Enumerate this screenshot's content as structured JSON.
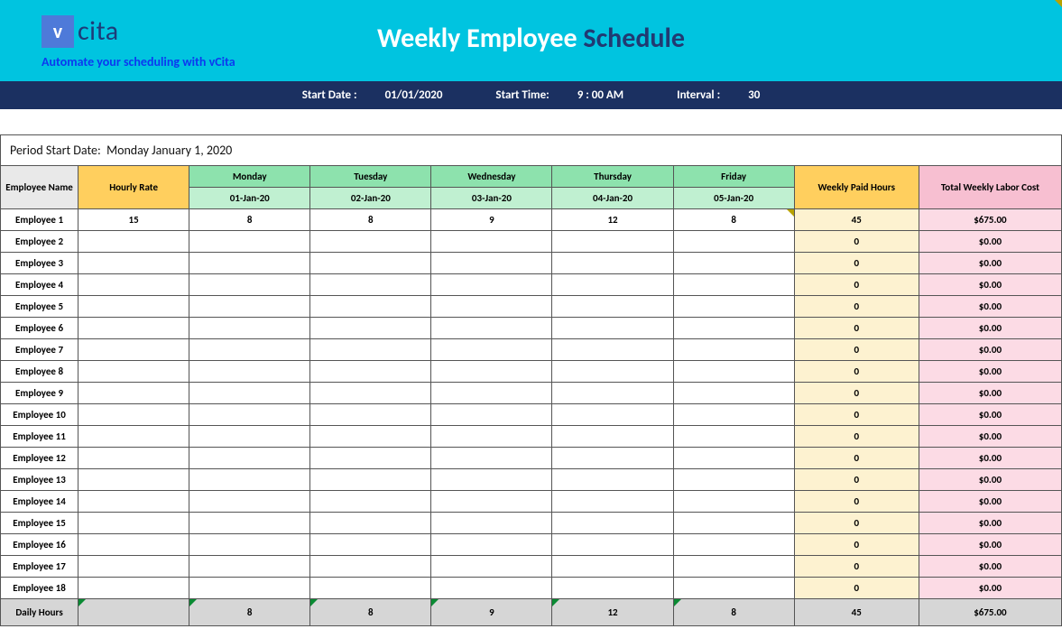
{
  "banner": {
    "logo_letter": "v",
    "logo_text": "cita",
    "tagline": "Automate your scheduling with vCita",
    "title_left": "Weekly Employee ",
    "title_right": "Schedule"
  },
  "infobar": {
    "start_date_label": "Start Date :",
    "start_date": "01/01/2020",
    "start_time_label": "Start Time:",
    "start_time": "9 : 00 AM",
    "interval_label": "Interval :",
    "interval": "30"
  },
  "period": {
    "label": "Period Start Date:",
    "value": "Monday January 1, 2020"
  },
  "headers": {
    "employee_name": "Employee Name",
    "hourly_rate": "Hourly Rate",
    "weekly_paid_hours": "Weekly Paid Hours",
    "total_cost": "Total Weekly Labor Cost",
    "daily_hours": "Daily Hours"
  },
  "days": [
    {
      "name": "Monday",
      "date": "01-Jan-20"
    },
    {
      "name": "Tuesday",
      "date": "02-Jan-20"
    },
    {
      "name": "Wednesday",
      "date": "03-Jan-20"
    },
    {
      "name": "Thursday",
      "date": "04-Jan-20"
    },
    {
      "name": "Friday",
      "date": "05-Jan-20"
    }
  ],
  "employees": [
    {
      "name": "Employee 1",
      "rate": "15",
      "hours": [
        "8",
        "8",
        "9",
        "12",
        "8"
      ],
      "weekly": "45",
      "cost": "$675.00"
    },
    {
      "name": "Employee 2",
      "rate": "",
      "hours": [
        "",
        "",
        "",
        "",
        ""
      ],
      "weekly": "0",
      "cost": "$0.00"
    },
    {
      "name": "Employee 3",
      "rate": "",
      "hours": [
        "",
        "",
        "",
        "",
        ""
      ],
      "weekly": "0",
      "cost": "$0.00"
    },
    {
      "name": "Employee 4",
      "rate": "",
      "hours": [
        "",
        "",
        "",
        "",
        ""
      ],
      "weekly": "0",
      "cost": "$0.00"
    },
    {
      "name": "Employee 5",
      "rate": "",
      "hours": [
        "",
        "",
        "",
        "",
        ""
      ],
      "weekly": "0",
      "cost": "$0.00"
    },
    {
      "name": "Employee 6",
      "rate": "",
      "hours": [
        "",
        "",
        "",
        "",
        ""
      ],
      "weekly": "0",
      "cost": "$0.00"
    },
    {
      "name": "Employee 7",
      "rate": "",
      "hours": [
        "",
        "",
        "",
        "",
        ""
      ],
      "weekly": "0",
      "cost": "$0.00"
    },
    {
      "name": "Employee 8",
      "rate": "",
      "hours": [
        "",
        "",
        "",
        "",
        ""
      ],
      "weekly": "0",
      "cost": "$0.00"
    },
    {
      "name": "Employee 9",
      "rate": "",
      "hours": [
        "",
        "",
        "",
        "",
        ""
      ],
      "weekly": "0",
      "cost": "$0.00"
    },
    {
      "name": "Employee 10",
      "rate": "",
      "hours": [
        "",
        "",
        "",
        "",
        ""
      ],
      "weekly": "0",
      "cost": "$0.00"
    },
    {
      "name": "Employee 11",
      "rate": "",
      "hours": [
        "",
        "",
        "",
        "",
        ""
      ],
      "weekly": "0",
      "cost": "$0.00"
    },
    {
      "name": "Employee 12",
      "rate": "",
      "hours": [
        "",
        "",
        "",
        "",
        ""
      ],
      "weekly": "0",
      "cost": "$0.00"
    },
    {
      "name": "Employee 13",
      "rate": "",
      "hours": [
        "",
        "",
        "",
        "",
        ""
      ],
      "weekly": "0",
      "cost": "$0.00"
    },
    {
      "name": "Employee 14",
      "rate": "",
      "hours": [
        "",
        "",
        "",
        "",
        ""
      ],
      "weekly": "0",
      "cost": "$0.00"
    },
    {
      "name": "Employee 15",
      "rate": "",
      "hours": [
        "",
        "",
        "",
        "",
        ""
      ],
      "weekly": "0",
      "cost": "$0.00"
    },
    {
      "name": "Employee 16",
      "rate": "",
      "hours": [
        "",
        "",
        "",
        "",
        ""
      ],
      "weekly": "0",
      "cost": "$0.00"
    },
    {
      "name": "Employee 17",
      "rate": "",
      "hours": [
        "",
        "",
        "",
        "",
        ""
      ],
      "weekly": "0",
      "cost": "$0.00"
    },
    {
      "name": "Employee 18",
      "rate": "",
      "hours": [
        "",
        "",
        "",
        "",
        ""
      ],
      "weekly": "0",
      "cost": "$0.00"
    }
  ],
  "totals": {
    "hours": [
      "8",
      "8",
      "9",
      "12",
      "8"
    ],
    "weekly": "45",
    "cost": "$675.00"
  }
}
